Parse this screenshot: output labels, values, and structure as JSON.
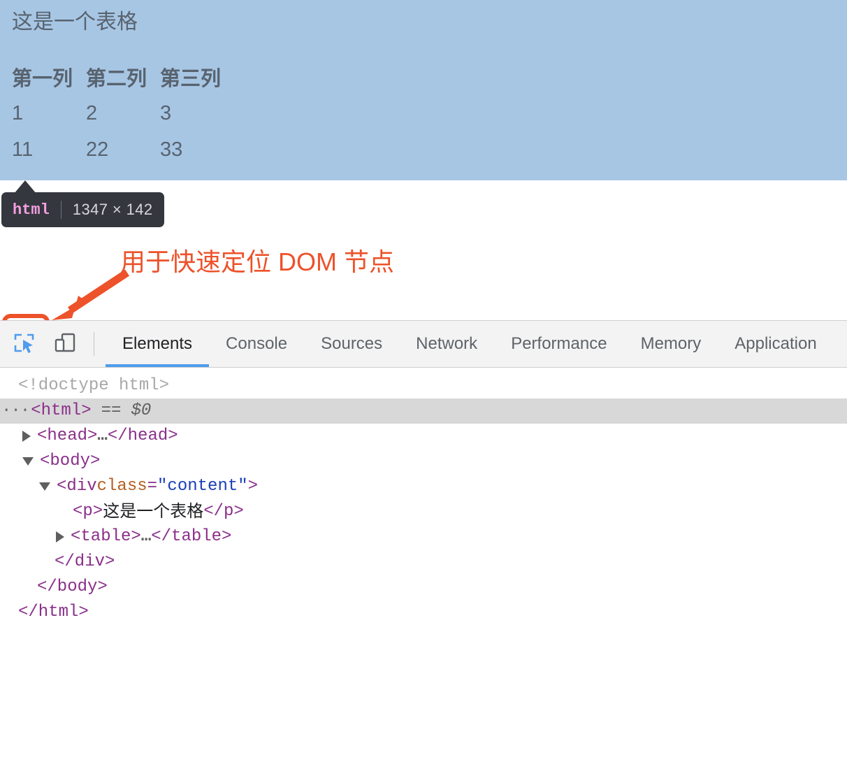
{
  "page": {
    "heading": "这是一个表格",
    "table": {
      "headers": [
        "第一列",
        "第二列",
        "第三列"
      ],
      "rows": [
        [
          "1",
          "2",
          "3"
        ],
        [
          "11",
          "22",
          "33"
        ]
      ]
    },
    "overlay_color": "#a7c6e4",
    "text_color": "#58636f"
  },
  "node_tooltip": {
    "tag": "html",
    "separator": "|",
    "size": "1347 × 142",
    "background": "#35373e",
    "tag_color": "#f29fe0"
  },
  "annotation": {
    "text": "用于快速定位 DOM 节点",
    "color": "#ed522a"
  },
  "devtools": {
    "toolbar": {
      "inspect_icon": "inspect-element-icon",
      "device_icon": "device-toolbar-icon"
    },
    "tabs": [
      {
        "label": "Elements",
        "active": true
      },
      {
        "label": "Console",
        "active": false
      },
      {
        "label": "Sources",
        "active": false
      },
      {
        "label": "Network",
        "active": false
      },
      {
        "label": "Performance",
        "active": false
      },
      {
        "label": "Memory",
        "active": false
      },
      {
        "label": "Application",
        "active": false
      }
    ],
    "active_tab_underline": "#4f9ced",
    "dom_tree": {
      "doctype": "<!doctype html>",
      "html_open": "<html>",
      "html_marker_dots": "···",
      "html_eq": "==",
      "html_ref": "$0",
      "head_open": "<head>",
      "head_ellipsis": "…",
      "head_close": "</head>",
      "body_open": "<body>",
      "div_open_prefix": "<div ",
      "div_attr_name": "class",
      "div_attr_eq": "=",
      "div_attr_value": "\"content\"",
      "div_open_suffix": ">",
      "p_open": "<p>",
      "p_text": "这是一个表格",
      "p_close": "</p>",
      "table_open": "<table>",
      "table_ellipsis": "…",
      "table_close": "</table>",
      "div_close": "</div>",
      "body_close": "</body>",
      "html_close": "</html>"
    }
  }
}
